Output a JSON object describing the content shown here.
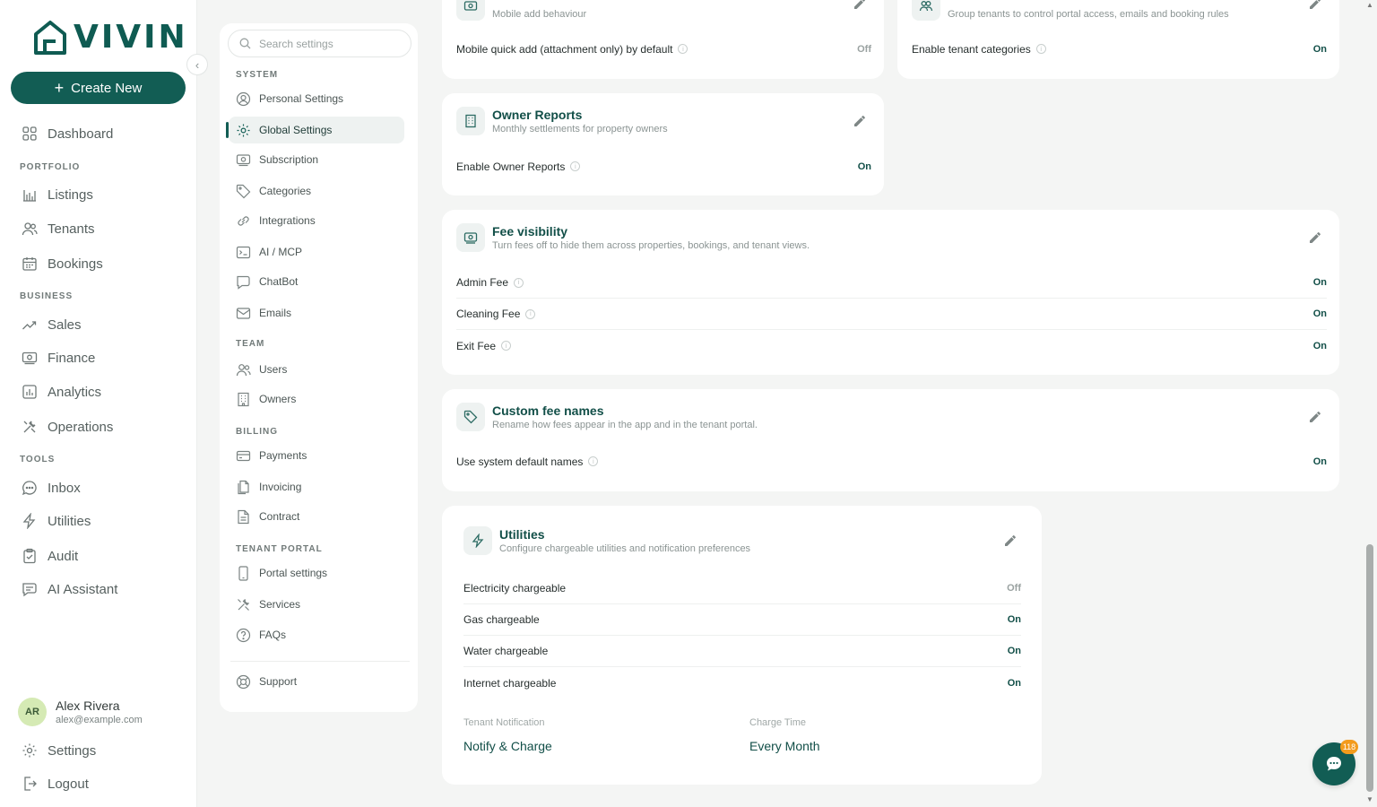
{
  "app": {
    "logo_text": "VIVIN",
    "brand_color": "#125d54"
  },
  "sidebar": {
    "create_label": "Create New",
    "items": [
      {
        "label": "Dashboard",
        "icon": "grid-icon"
      },
      {
        "label": "Listings",
        "icon": "building-chart-icon"
      },
      {
        "label": "Tenants",
        "icon": "users-icon"
      },
      {
        "label": "Bookings",
        "icon": "calendar-icon"
      },
      {
        "label": "Sales",
        "icon": "trend-up-icon"
      },
      {
        "label": "Finance",
        "icon": "banknote-icon"
      },
      {
        "label": "Analytics",
        "icon": "bar-chart-icon"
      },
      {
        "label": "Operations",
        "icon": "tools-icon"
      },
      {
        "label": "Inbox",
        "icon": "message-icon"
      },
      {
        "label": "Utilities",
        "icon": "bolt-icon"
      },
      {
        "label": "Audit",
        "icon": "clipboard-check-icon"
      },
      {
        "label": "AI Assistant",
        "icon": "chat-bubble-icon"
      }
    ],
    "sections": [
      "PORTFOLIO",
      "BUSINESS",
      "TOOLS"
    ],
    "user": {
      "initials": "AR",
      "name": "Alex Rivera",
      "email": "alex@example.com"
    },
    "settings_label": "Settings",
    "logout_label": "Logout"
  },
  "settings_nav": {
    "search_placeholder": "Search settings",
    "sections": [
      "SYSTEM",
      "TEAM",
      "BILLING",
      "TENANT PORTAL"
    ],
    "items": [
      {
        "label": "Personal Settings",
        "icon": "user-circle-icon"
      },
      {
        "label": "Global Settings",
        "icon": "gear-icon",
        "active": true
      },
      {
        "label": "Subscription",
        "icon": "banknote-icon"
      },
      {
        "label": "Categories",
        "icon": "tag-icon"
      },
      {
        "label": "Integrations",
        "icon": "link-icon"
      },
      {
        "label": "AI / MCP",
        "icon": "terminal-icon"
      },
      {
        "label": "ChatBot",
        "icon": "chat-bubble-icon"
      },
      {
        "label": "Emails",
        "icon": "mail-icon"
      },
      {
        "label": "Users",
        "icon": "users-icon"
      },
      {
        "label": "Owners",
        "icon": "building-icon"
      },
      {
        "label": "Payments",
        "icon": "credit-card-icon"
      },
      {
        "label": "Invoicing",
        "icon": "documents-icon"
      },
      {
        "label": "Contract",
        "icon": "file-text-icon"
      },
      {
        "label": "Portal settings",
        "icon": "smartphone-icon"
      },
      {
        "label": "Services",
        "icon": "tools-icon"
      },
      {
        "label": "FAQs",
        "icon": "help-circle-icon"
      }
    ],
    "support_label": "Support"
  },
  "cards": {
    "cash_flows": {
      "subtitle": "Mobile add behaviour",
      "rows": [
        {
          "label": "Mobile quick add (attachment only) by default",
          "value": "Off"
        }
      ]
    },
    "tenant_categories": {
      "subtitle": "Group tenants to control portal access, emails and booking rules",
      "rows": [
        {
          "label": "Enable tenant categories",
          "value": "On"
        }
      ]
    },
    "owner_reports": {
      "title": "Owner Reports",
      "subtitle": "Monthly settlements for property owners",
      "rows": [
        {
          "label": "Enable Owner Reports",
          "value": "On"
        }
      ]
    },
    "fee_visibility": {
      "title": "Fee visibility",
      "subtitle": "Turn fees off to hide them across properties, bookings, and tenant views.",
      "rows": [
        {
          "label": "Admin Fee",
          "value": "On"
        },
        {
          "label": "Cleaning Fee",
          "value": "On"
        },
        {
          "label": "Exit Fee",
          "value": "On"
        }
      ]
    },
    "custom_fee_names": {
      "title": "Custom fee names",
      "subtitle": "Rename how fees appear in the app and in the tenant portal.",
      "rows": [
        {
          "label": "Use system default names",
          "value": "On"
        }
      ]
    },
    "utilities": {
      "title": "Utilities",
      "subtitle": "Configure chargeable utilities and notification preferences",
      "rows": [
        {
          "label": "Electricity chargeable",
          "value": "Off"
        },
        {
          "label": "Gas chargeable",
          "value": "On"
        },
        {
          "label": "Water chargeable",
          "value": "On"
        },
        {
          "label": "Internet chargeable",
          "value": "On"
        }
      ],
      "tenant_notification_label": "Tenant Notification",
      "tenant_notification_value": "Notify & Charge",
      "charge_time_label": "Charge Time",
      "charge_time_value": "Every Month"
    }
  },
  "chat": {
    "badge": "118"
  }
}
